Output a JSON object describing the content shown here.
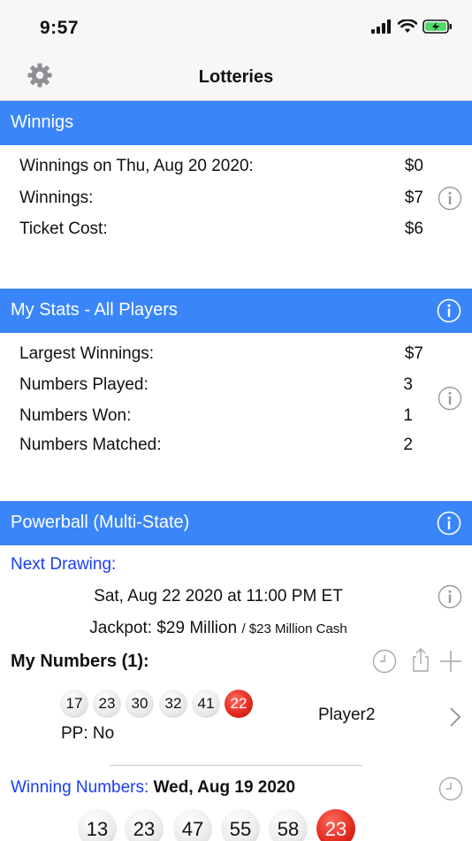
{
  "status": {
    "time": "9:57"
  },
  "nav": {
    "title": "Lotteries"
  },
  "winnings": {
    "header": "Winnigs",
    "rows": [
      {
        "label": "Winnings on Thu, Aug 20 2020:",
        "value": "$0"
      },
      {
        "label": "Winnings:",
        "value": "$7"
      },
      {
        "label": "Ticket Cost:",
        "value": "$6"
      }
    ]
  },
  "stats": {
    "header": "My Stats - All Players",
    "rows": [
      {
        "label": "Largest Winnings:",
        "value": "$7"
      },
      {
        "label": "Numbers Played:",
        "value": "3"
      },
      {
        "label": "Numbers Won:",
        "value": "1"
      },
      {
        "label": "Numbers Matched:",
        "value": "2"
      }
    ]
  },
  "powerball": {
    "header": "Powerball (Multi-State)",
    "next_drawing_label": "Next Drawing:",
    "drawing_date": "Sat, Aug 22 2020 at 11:00 PM ET",
    "jackpot": "Jackpot: $29 Million",
    "cash": "/ $23 Million Cash",
    "my_numbers_label": "My Numbers (1):",
    "my_numbers": [
      "17",
      "23",
      "30",
      "32",
      "41"
    ],
    "my_powerball": "22",
    "pp": "PP:  No",
    "player": "Player2",
    "winning_label": "Winning Numbers:",
    "winning_date": "Wed, Aug 19 2020",
    "winning_numbers": [
      "13",
      "23",
      "47",
      "55",
      "58"
    ],
    "winning_powerball": "23"
  },
  "colors": {
    "accent": "#3a86f8",
    "link": "#1a3ef0",
    "powerball": "#e2281d"
  }
}
